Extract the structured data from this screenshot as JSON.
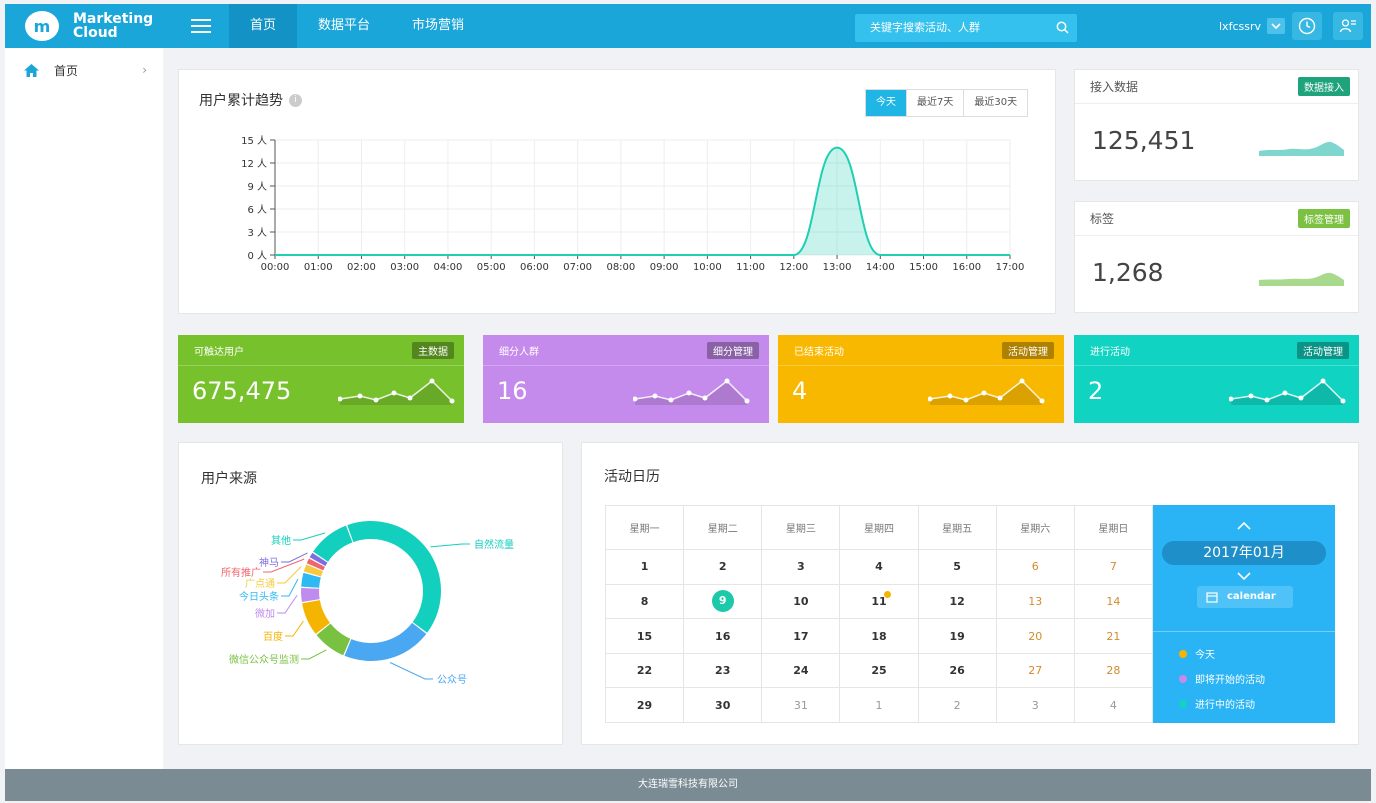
{
  "header": {
    "logo_line1": "Marketing",
    "logo_line2": "Cloud",
    "nav": [
      "首页",
      "数据平台",
      "市场营销"
    ],
    "search_placeholder": "关键字搜索活动、人群",
    "username": "lxfcssrv"
  },
  "sidebar": {
    "items": [
      {
        "label": "首页",
        "icon": "home-icon"
      }
    ]
  },
  "trend": {
    "title": "用户累计趋势",
    "ranges": [
      "今天",
      "最近7天",
      "最近30天"
    ],
    "chart_data": {
      "type": "area",
      "x": [
        "00:00",
        "01:00",
        "02:00",
        "03:00",
        "04:00",
        "05:00",
        "06:00",
        "07:00",
        "08:00",
        "09:00",
        "10:00",
        "11:00",
        "12:00",
        "13:00",
        "14:00",
        "15:00",
        "16:00",
        "17:00"
      ],
      "y_ticks": [
        "0 人",
        "3 人",
        "6 人",
        "9 人",
        "12 人",
        "15 人"
      ],
      "values": [
        0,
        0,
        0,
        0,
        0,
        0,
        0,
        0,
        0,
        0,
        0,
        0,
        0,
        14,
        0,
        0,
        0,
        0
      ],
      "ylim": [
        0,
        15
      ],
      "color": "#1fcfb2",
      "grid": true
    }
  },
  "access": {
    "title": "接入数据",
    "tag": "数据接入",
    "value": "125,451",
    "tag_color": "#1fa37a"
  },
  "tags": {
    "title": "标签",
    "tag": "标签管理",
    "value": "1,268",
    "tag_color": "#7cc142"
  },
  "stats": [
    {
      "title": "可触达用户",
      "tag": "主数据",
      "value": "675,475",
      "color": "#77c12d"
    },
    {
      "title": "细分人群",
      "tag": "细分管理",
      "value": "16",
      "color": "#c58bec"
    },
    {
      "title": "已结束活动",
      "tag": "活动管理",
      "value": "4",
      "color": "#f9b800"
    },
    {
      "title": "进行活动",
      "tag": "活动管理",
      "value": "2",
      "color": "#10d3c1"
    }
  ],
  "source": {
    "title": "用户来源",
    "chart_data": {
      "type": "pie",
      "series": [
        {
          "name": "自然流量",
          "value": 41,
          "color": "#13cfbd"
        },
        {
          "name": "公众号",
          "value": 21,
          "color": "#4aa7f2"
        },
        {
          "name": "微信公众号监测",
          "value": 8,
          "color": "#79c141"
        },
        {
          "name": "百度",
          "value": 8,
          "color": "#f5b400"
        },
        {
          "name": "微加",
          "value": 3.5,
          "color": "#bf8bee"
        },
        {
          "name": "今日头条",
          "value": 3.5,
          "color": "#2fb9f2"
        },
        {
          "name": "广点通",
          "value": 2,
          "color": "#f7c93e"
        },
        {
          "name": "所有推广",
          "value": 1.5,
          "color": "#f0666e"
        },
        {
          "name": "神马",
          "value": 1.5,
          "color": "#7a6ee0"
        },
        {
          "name": "其他",
          "value": 10,
          "color": "#13cfbd"
        }
      ]
    }
  },
  "calendar": {
    "title": "活动日历",
    "weekdays": [
      "星期一",
      "星期二",
      "星期三",
      "星期四",
      "星期五",
      "星期六",
      "星期日"
    ],
    "month": "2017年01月",
    "button": "calendar",
    "legend": [
      {
        "label": "今天",
        "color": "#f5b400"
      },
      {
        "label": "即将开始的活动",
        "color": "#c58bec"
      },
      {
        "label": "进行中的活动",
        "color": "#10d3c1"
      }
    ],
    "weeks": [
      [
        "1",
        "2",
        "3",
        "4",
        "5",
        "6",
        "7"
      ],
      [
        "8",
        "9",
        "10",
        "11",
        "12",
        "13",
        "14"
      ],
      [
        "15",
        "16",
        "17",
        "18",
        "19",
        "20",
        "21"
      ],
      [
        "22",
        "23",
        "24",
        "25",
        "26",
        "27",
        "28"
      ],
      [
        "29",
        "30",
        "31",
        "1",
        "2",
        "3",
        "4"
      ]
    ]
  },
  "footer": {
    "text": "大连瑞雪科技有限公司"
  }
}
